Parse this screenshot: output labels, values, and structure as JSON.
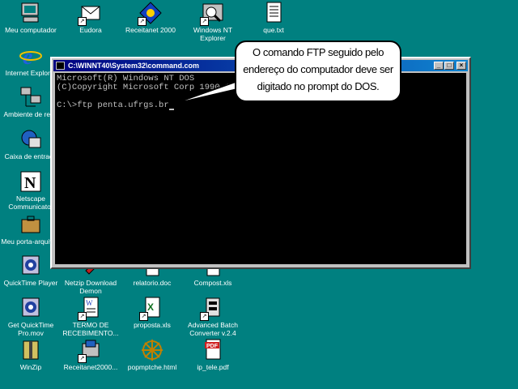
{
  "desktop": {
    "icons": [
      {
        "label": "Meu computador",
        "icon": "computer-icon"
      },
      {
        "label": "Eudora",
        "icon": "eudora-icon"
      },
      {
        "label": "Receitanet 2000",
        "icon": "receitanet-icon"
      },
      {
        "label": "Windows NT Explorer",
        "icon": "explorer-icon"
      },
      {
        "label": "que.txt",
        "icon": "text-file-icon"
      },
      {
        "label": "Internet Explorer",
        "icon": "internet-explorer-icon"
      },
      {
        "label": "Ambiente de rede",
        "icon": "network-icon"
      },
      {
        "label": "Caixa de entrada",
        "icon": "inbox-icon"
      },
      {
        "label": "Netscape Communicator",
        "icon": "netscape-icon"
      },
      {
        "label": "Meu porta-arquivos",
        "icon": "briefcase-icon"
      },
      {
        "label": "QuickTime Player",
        "icon": "quicktime-icon"
      },
      {
        "label": "Netzip Download Demon",
        "icon": "netzip-icon"
      },
      {
        "label": "relatorio.doc",
        "icon": "word-doc-icon"
      },
      {
        "label": "Compost.xls",
        "icon": "excel-icon"
      },
      {
        "label": "Get QuickTime Pro.mov",
        "icon": "quicktime-movie-icon"
      },
      {
        "label": "TERMO DE RECEBIMENTO...",
        "icon": "word-doc-icon"
      },
      {
        "label": "proposta.xls",
        "icon": "excel-icon"
      },
      {
        "label": "Advanced Batch Converter v.2.4",
        "icon": "converter-icon"
      },
      {
        "label": "WinZip",
        "icon": "winzip-icon"
      },
      {
        "label": "Receitanet2000...",
        "icon": "installer-icon"
      },
      {
        "label": "popmptche.html",
        "icon": "html-file-icon"
      },
      {
        "label": "ip_tele.pdf",
        "icon": "pdf-icon"
      }
    ]
  },
  "command_window": {
    "title": "C:\\WINNT40\\System32\\command.com",
    "minimize": "_",
    "maximize": "□",
    "close": "×",
    "lines": [
      "Microsoft(R) Windows NT DOS",
      "(C)Copyright Microsoft Corp 1990-1996.",
      "",
      "C:\\>ftp penta.ufrgs.br"
    ]
  },
  "callout": {
    "text": "O comando FTP seguido pelo endereço do computador deve ser digitado no prompt do DOS."
  }
}
